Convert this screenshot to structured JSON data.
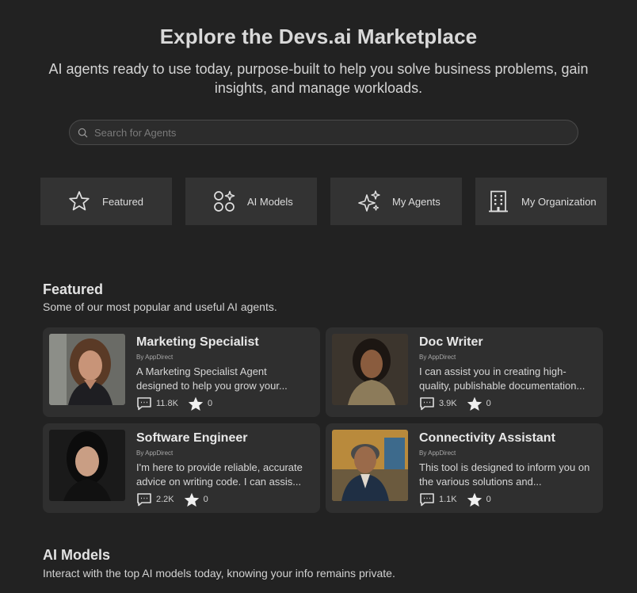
{
  "hero": {
    "title": "Explore the Devs.ai Marketplace",
    "subtitle": "AI agents ready to use today, purpose-built to help you solve business problems, gain insights, and manage workloads."
  },
  "search": {
    "placeholder": "Search for Agents",
    "value": ""
  },
  "tabs": [
    {
      "label": "Featured",
      "icon": "star-icon"
    },
    {
      "label": "AI Models",
      "icon": "ai-models-icon"
    },
    {
      "label": "My Agents",
      "icon": "sparkles-icon"
    },
    {
      "label": "My Organization",
      "icon": "building-icon"
    }
  ],
  "featured": {
    "title": "Featured",
    "subtitle": "Some of our most popular and useful AI agents.",
    "cards": [
      {
        "name": "Marketing Specialist",
        "by": "By AppDirect",
        "description": "A Marketing Specialist Agent designed to help you grow your...",
        "messages": "11.8K",
        "stars": "0"
      },
      {
        "name": "Doc Writer",
        "by": "By AppDirect",
        "description": "I can assist you in creating high-quality, publishable documentation...",
        "messages": "3.9K",
        "stars": "0"
      },
      {
        "name": "Software Engineer",
        "by": "By AppDirect",
        "description": "I'm here to provide reliable, accurate advice on writing code. I can assis...",
        "messages": "2.2K",
        "stars": "0"
      },
      {
        "name": "Connectivity Assistant",
        "by": "By AppDirect",
        "description": "This tool is designed to inform you on the various solutions and...",
        "messages": "1.1K",
        "stars": "0"
      }
    ]
  },
  "ai_models": {
    "title": "AI Models",
    "subtitle": "Interact with the top AI models today, knowing your info remains private."
  },
  "colors": {
    "background": "#222222",
    "card": "#2f2f2f",
    "tab": "#333333",
    "text": "#e6e6e6"
  }
}
